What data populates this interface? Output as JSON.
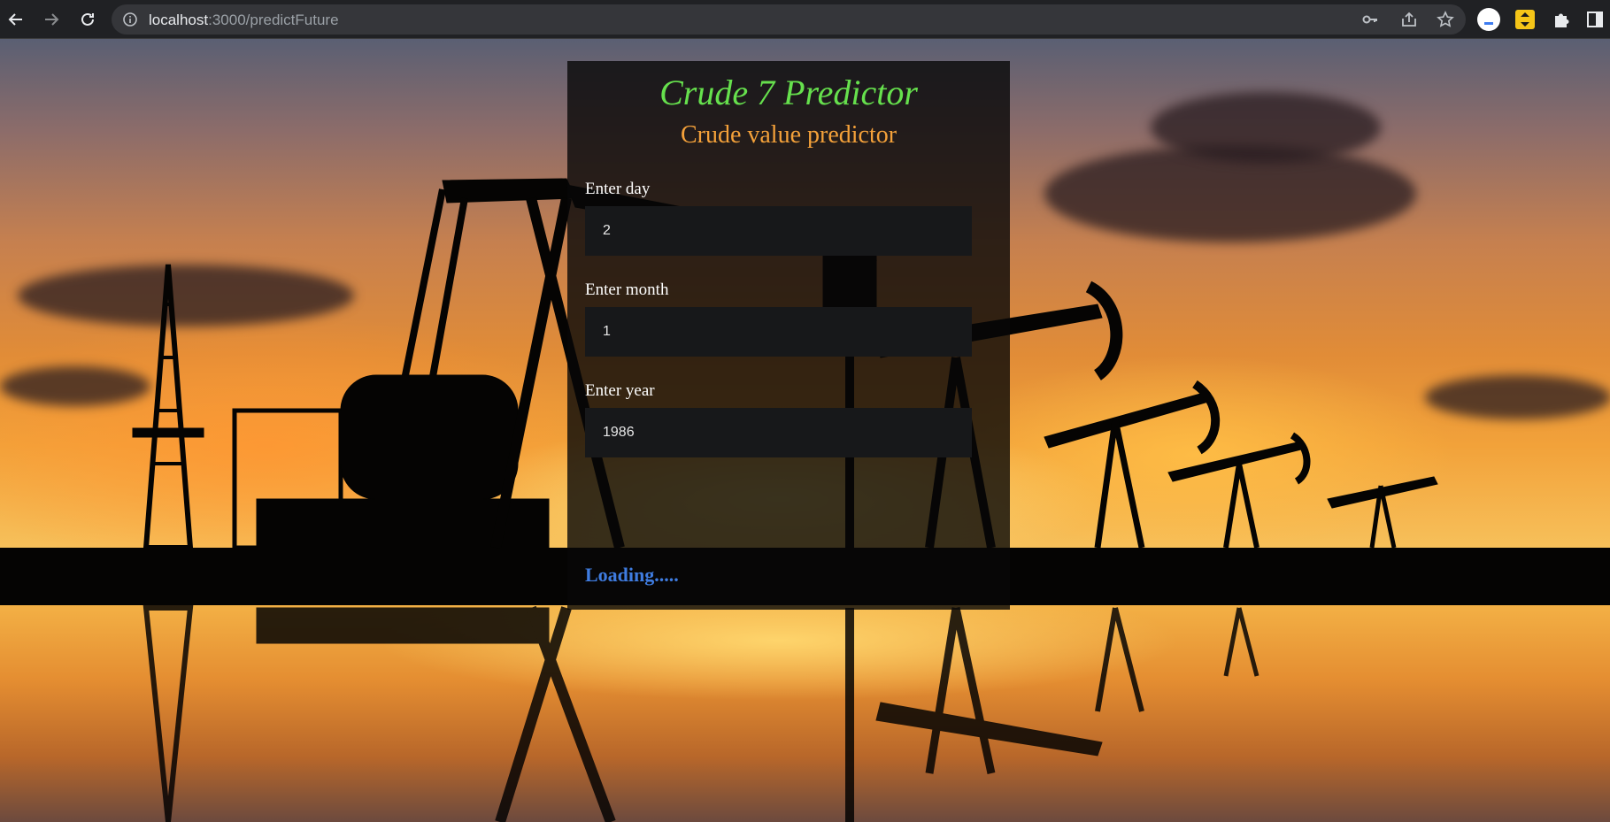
{
  "browser": {
    "url_host": "localhost",
    "url_path": ":3000/predictFuture"
  },
  "page": {
    "title": "Crude 7 Predictor",
    "subtitle": "Crude value predictor",
    "fields": [
      {
        "label": "Enter day",
        "value": "2"
      },
      {
        "label": "Enter month",
        "value": "1"
      },
      {
        "label": "Enter year",
        "value": "1986"
      }
    ],
    "status": "Loading....."
  },
  "colors": {
    "title": "#66e04d",
    "subtitle": "#f4a13a",
    "status": "#3f7ce0",
    "chrome": "#202124"
  },
  "icons": [
    "back-arrow-icon",
    "forward-arrow-icon",
    "reload-icon",
    "info-icon",
    "key-icon",
    "share-icon",
    "star-icon",
    "profile-icon",
    "extension-icon",
    "puzzle-icon",
    "side-panel-icon"
  ]
}
